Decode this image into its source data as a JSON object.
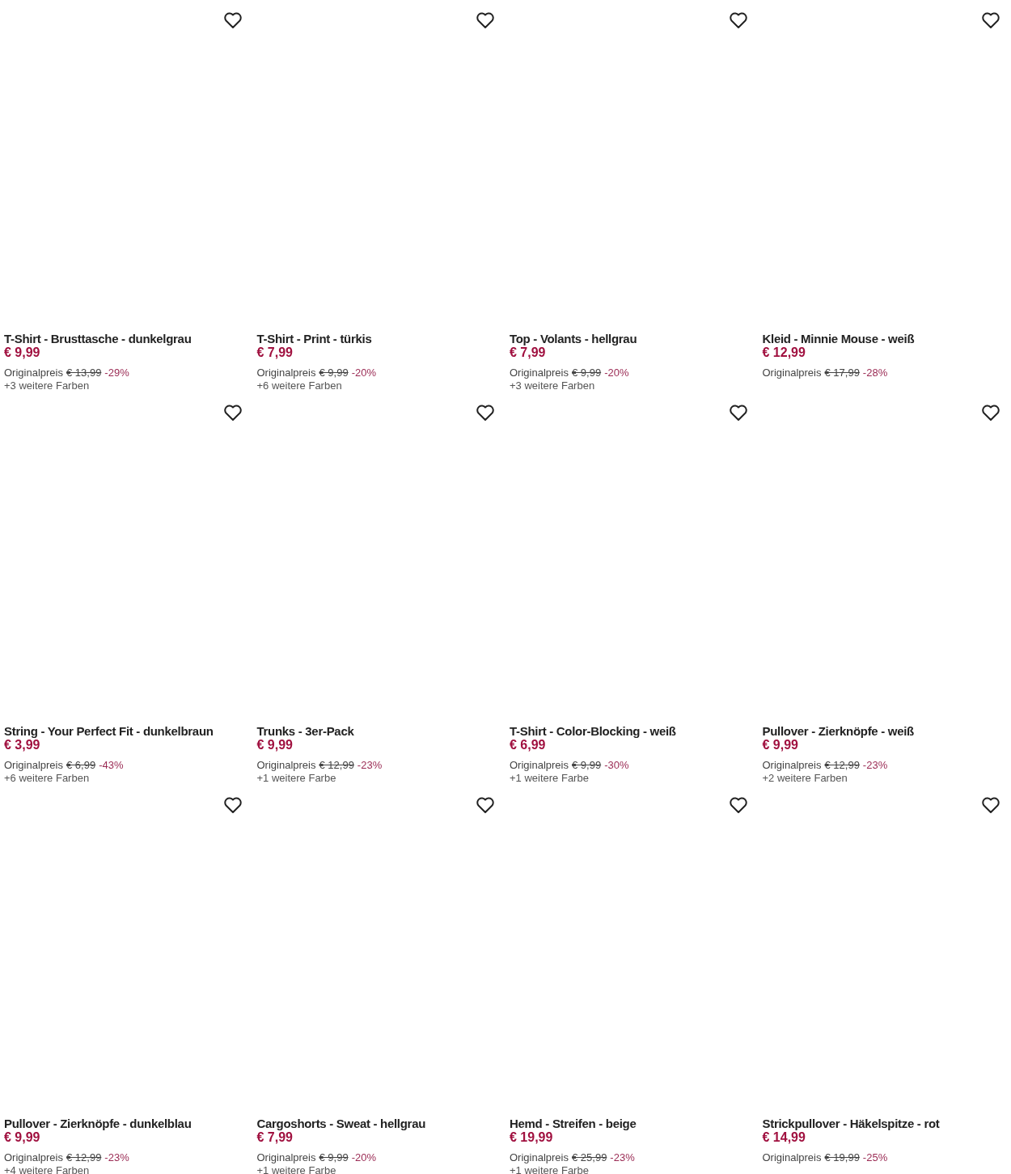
{
  "products": [
    {
      "title": "T-Shirt - Brusttasche - dunkelgrau",
      "price": "€ 9,99",
      "original_label": "Originalpreis",
      "original_price": "€ 13,99",
      "discount": "-29%",
      "colors": "+3 weitere Farben"
    },
    {
      "title": "T-Shirt - Print - türkis",
      "price": "€ 7,99",
      "original_label": "Originalpreis",
      "original_price": "€ 9,99",
      "discount": "-20%",
      "colors": "+6 weitere Farben"
    },
    {
      "title": "Top - Volants - hellgrau",
      "price": "€ 7,99",
      "original_label": "Originalpreis",
      "original_price": "€ 9,99",
      "discount": "-20%",
      "colors": "+3 weitere Farben"
    },
    {
      "title": "Kleid - Minnie Mouse - weiß",
      "price": "€ 12,99",
      "original_label": "Originalpreis",
      "original_price": "€ 17,99",
      "discount": "-28%"
    },
    {
      "title": "String - Your Perfect Fit - dunkelbraun",
      "price": "€ 3,99",
      "original_label": "Originalpreis",
      "original_price": "€ 6,99",
      "discount": "-43%",
      "colors": "+6 weitere Farben"
    },
    {
      "title": "Trunks - 3er-Pack",
      "price": "€ 9,99",
      "original_label": "Originalpreis",
      "original_price": "€ 12,99",
      "discount": "-23%",
      "colors": "+1 weitere Farbe"
    },
    {
      "title": "T-Shirt - Color-Blocking - weiß",
      "price": "€ 6,99",
      "original_label": "Originalpreis",
      "original_price": "€ 9,99",
      "discount": "-30%",
      "colors": "+1 weitere Farbe"
    },
    {
      "title": "Pullover - Zierknöpfe - weiß",
      "price": "€ 9,99",
      "original_label": "Originalpreis",
      "original_price": "€ 12,99",
      "discount": "-23%",
      "colors": "+2 weitere Farben"
    },
    {
      "title": "Pullover - Zierknöpfe - dunkelblau",
      "price": "€ 9,99",
      "original_label": "Originalpreis",
      "original_price": "€ 12,99",
      "discount": "-23%",
      "colors": "+4 weitere Farben"
    },
    {
      "title": "Cargoshorts - Sweat - hellgrau",
      "price": "€ 7,99",
      "original_label": "Originalpreis",
      "original_price": "€ 9,99",
      "discount": "-20%",
      "colors": "+1 weitere Farbe"
    },
    {
      "title": "Hemd - Streifen - beige",
      "price": "€ 19,99",
      "original_label": "Originalpreis",
      "original_price": "€ 25,99",
      "discount": "-23%",
      "colors": "+1 weitere Farbe"
    },
    {
      "title": "Strickpullover - Häkelspitze - rot",
      "price": "€ 14,99",
      "original_label": "Originalpreis",
      "original_price": "€ 19,99",
      "discount": "-25%"
    }
  ]
}
